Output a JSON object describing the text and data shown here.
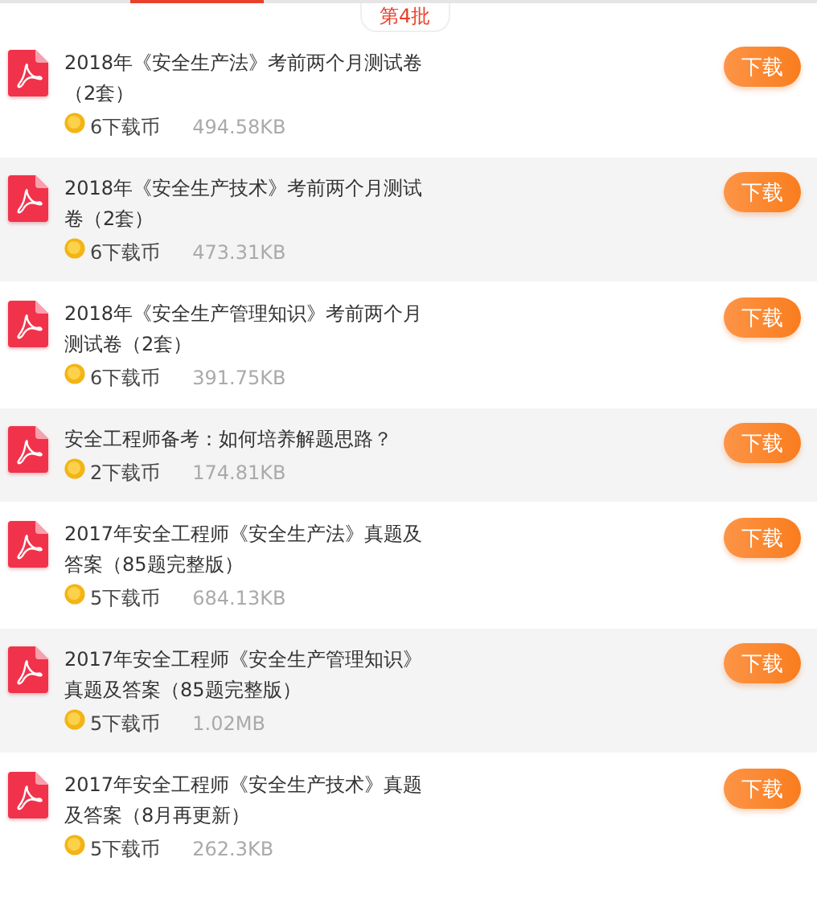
{
  "batch_label": "第4批",
  "files": [
    {
      "title": "2018年《安全生产法》考前两个月测试卷（2套）",
      "coins": "6下载币",
      "size": "494.58KB",
      "button": "下载"
    },
    {
      "title": "2018年《安全生产技术》考前两个月测试卷（2套）",
      "coins": "6下载币",
      "size": "473.31KB",
      "button": "下载"
    },
    {
      "title": "2018年《安全生产管理知识》考前两个月测试卷（2套）",
      "coins": "6下载币",
      "size": "391.75KB",
      "button": "下载"
    },
    {
      "title": "安全工程师备考：如何培养解题思路？",
      "coins": "2下载币",
      "size": "174.81KB",
      "button": "下载"
    },
    {
      "title": "2017年安全工程师《安全生产法》真题及答案（85题完整版）",
      "coins": "5下载币",
      "size": "684.13KB",
      "button": "下载"
    },
    {
      "title": "2017年安全工程师《安全生产管理知识》真题及答案（85题完整版）",
      "coins": "5下载币",
      "size": "1.02MB",
      "button": "下载"
    },
    {
      "title": "2017年安全工程师《安全生产技术》真题及答案（8月再更新）",
      "coins": "5下载币",
      "size": "262.3KB",
      "button": "下载"
    }
  ]
}
